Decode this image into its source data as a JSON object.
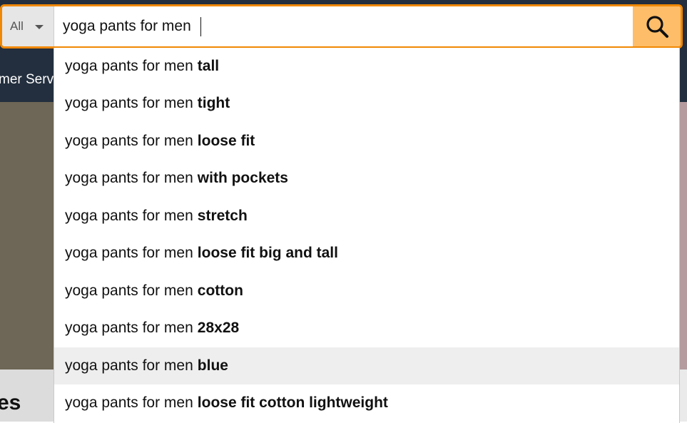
{
  "header": {
    "nav_partial_text": "mer Serv"
  },
  "background": {
    "partial_heading": "es"
  },
  "search": {
    "scope_label": "All",
    "query": "yoga pants for men",
    "submit_icon": "search-icon",
    "accent_color": "#f08804",
    "button_color": "#febd69"
  },
  "suggestions": {
    "prefix": "yoga pants for men",
    "items": [
      {
        "completion": "tall"
      },
      {
        "completion": "tight"
      },
      {
        "completion": "loose fit"
      },
      {
        "completion": "with pockets"
      },
      {
        "completion": "stretch"
      },
      {
        "completion": "loose fit big and tall"
      },
      {
        "completion": "cotton"
      },
      {
        "completion": "28x28"
      },
      {
        "completion": "blue",
        "highlighted": true
      },
      {
        "completion": "loose fit cotton lightweight"
      }
    ]
  }
}
